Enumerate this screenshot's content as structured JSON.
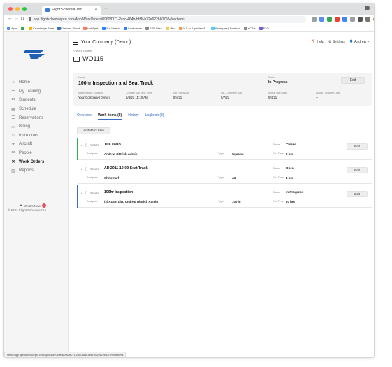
{
  "browser": {
    "tab_title": "Flight Schedule Pro",
    "url": "app.flightschedulepro.com/App/WorkOrders/09608071-2ccc-464b-bb8f-b32e62266079/Workitems",
    "bookmarks": [
      "Apps",
      "",
      "Knowledge Base",
      "Devices Sheet",
      "HubSpot",
      "Jira Search",
      "Confluence",
      "FSP Sites",
      "Miro",
      "Q & As Updates &...",
      "Examples | Bryntum",
      "eCPIs",
      "FTO"
    ],
    "status_url": "https://app.flightschedulepro.com/App/WorkOrders/09608071-2ccc-464b-bb8f-b32e62266079/Workitems",
    "colors": {
      "close": "#fe5f57",
      "min": "#febc2e",
      "max": "#28c840"
    }
  },
  "sidebar": {
    "items": [
      {
        "label": "Home",
        "icon": "home-icon",
        "glyph": "⌂"
      },
      {
        "label": "My Training",
        "icon": "training-icon",
        "glyph": "☰"
      },
      {
        "label": "Students",
        "icon": "students-icon",
        "glyph": "☷"
      },
      {
        "label": "Schedule",
        "icon": "schedule-icon",
        "glyph": "▦"
      },
      {
        "label": "Reservations",
        "icon": "reservations-icon",
        "glyph": "☰"
      },
      {
        "label": "Billing",
        "icon": "billing-icon",
        "glyph": "▭"
      },
      {
        "label": "Instructors",
        "icon": "instructors-icon",
        "glyph": "☺"
      },
      {
        "label": "Aircraft",
        "icon": "aircraft-icon",
        "glyph": "✈"
      },
      {
        "label": "People",
        "icon": "people-icon",
        "glyph": "☷"
      },
      {
        "label": "Work Orders",
        "icon": "work-orders-icon",
        "glyph": "✕"
      },
      {
        "label": "Reports",
        "icon": "reports-icon",
        "glyph": "▥"
      }
    ],
    "whats_new": "What's New",
    "whats_new_count": "",
    "copyright": "© 2021 Flight Schedule Pro"
  },
  "header": {
    "company": "Your Company (Demo)",
    "help": "Help",
    "settings": "Settings",
    "user": "Andrew"
  },
  "breadcrumb": "< Work Orders",
  "work_order": {
    "id": "WO115",
    "name_label": "Name",
    "name": "100hr Inspection and Seat Track",
    "status_label": "Status",
    "status": "In Progress",
    "edit_label": "Edit",
    "fields": [
      {
        "label": "Maintenance Location",
        "value": "Your Company (Demo)"
      },
      {
        "label": "Created Date and Time",
        "value": "5/4/21 11:10 AM"
      },
      {
        "label": "Est. Start Date",
        "value": "5/4/21"
      },
      {
        "label": "Est. Complete Date",
        "value": "5/7/21"
      },
      {
        "label": "Actual Start Date",
        "value": "5/4/21"
      },
      {
        "label": "Actual Complete Date",
        "value": "--"
      }
    ]
  },
  "tabs": [
    {
      "label": "Overview",
      "active": false
    },
    {
      "label": "Work Items (3)",
      "active": true
    },
    {
      "label": "History",
      "active": false
    },
    {
      "label": "Logbook (3)",
      "active": false
    }
  ],
  "add_work_item": "Add Work Item",
  "work_items": [
    {
      "code": "WI121",
      "name": "Tire swap",
      "assignee_label": "Assignee",
      "assignee": "Andrew Dittrich Admin",
      "type_label": "Type",
      "type": "Squawk",
      "status_label": "Status",
      "status": "Closed",
      "time_label": "Est. Time",
      "time": "2 hrs",
      "edit": "Edit",
      "bar_color": "#2db34a"
    },
    {
      "code": "WI120",
      "name": "AD 2011-10-09 Seat Track",
      "assignee_label": "Assignee",
      "assignee": "Chris Harf",
      "type_label": "Type",
      "type": "AD",
      "status_label": "Status",
      "status": "Open",
      "time_label": "Est. Time",
      "time": "4 hrs",
      "edit": "Edit",
      "bar_color": "#ffffff"
    },
    {
      "code": "WI119",
      "name": "100hr Inspection",
      "assignee_label": "Assignee",
      "assignee": "(2) Adam Litz, Andrew Dittrich Admin",
      "type_label": "Type",
      "type": "100 hr",
      "status_label": "Status",
      "status": "In Progress",
      "time_label": "Est. Time",
      "time": "20 hrs",
      "edit": "Edit",
      "bar_color": "#3a6fc8"
    }
  ]
}
